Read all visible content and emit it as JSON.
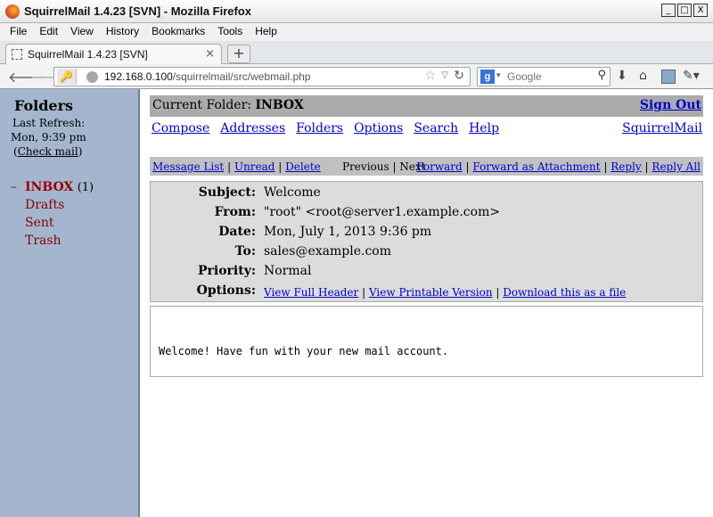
{
  "window": {
    "title": "SquirrelMail 1.4.23 [SVN] - Mozilla Firefox",
    "min_label": "_",
    "max_label": "□",
    "close_label": "X"
  },
  "menubar": [
    "File",
    "Edit",
    "View",
    "History",
    "Bookmarks",
    "Tools",
    "Help"
  ],
  "tab": {
    "label": "SquirrelMail 1.4.23 [SVN]",
    "close": "×",
    "new_tab": "+"
  },
  "nav": {
    "url_host": "192.168.0.100",
    "url_path": "/squirrelmail/src/webmail.php",
    "search_placeholder": "Google",
    "search_engine_letter": "g",
    "icons": [
      "back-icon",
      "forward-icon",
      "key-icon",
      "globe-icon",
      "bookmark-star-icon",
      "reload-icon",
      "search-icon",
      "download-icon",
      "home-icon",
      "avatar-icon",
      "tools-icon"
    ]
  },
  "left": {
    "title": "Folders",
    "last_refresh_label": "Last Refresh:",
    "last_refresh_time": "Mon, 9:39 pm",
    "check_mail_open": "(",
    "check_mail": "Check mail",
    "check_mail_close": ")",
    "folders": [
      {
        "dash": "–",
        "name": "INBOX",
        "count": "(1)"
      },
      {
        "dash": "",
        "name": "Drafts",
        "count": ""
      },
      {
        "dash": "",
        "name": "Sent",
        "count": ""
      },
      {
        "dash": "",
        "name": "Trash",
        "count": ""
      }
    ]
  },
  "main": {
    "current_folder_label": "Current Folder:",
    "current_folder": "INBOX",
    "sign_out": "Sign Out",
    "nav_links": [
      "Compose",
      "Addresses",
      "Folders",
      "Options",
      "Search",
      "Help"
    ],
    "brand_link": "SquirrelMail",
    "msgbar": {
      "message_list": "Message List",
      "unread": "Unread",
      "delete": "Delete",
      "previous": "Previous",
      "next": "Next",
      "forward": "Forward",
      "forward_attachment": "Forward as Attachment",
      "reply": "Reply",
      "reply_all": "Reply All",
      "sep": "|"
    },
    "headers": {
      "subject_label": "Subject:",
      "subject": "Welcome",
      "from_label": "From:",
      "from": "\"root\" <root@server1.example.com>",
      "date_label": "Date:",
      "date": "Mon, July 1, 2013 9:36 pm",
      "to_label": "To:",
      "to": "sales@example.com",
      "priority_label": "Priority:",
      "priority": "Normal",
      "options_label": "Options:",
      "view_full_header": "View Full Header",
      "view_printable": "View Printable Version",
      "download_file": "Download this as a file"
    },
    "body": "Welcome! Have fun with your new mail account."
  }
}
